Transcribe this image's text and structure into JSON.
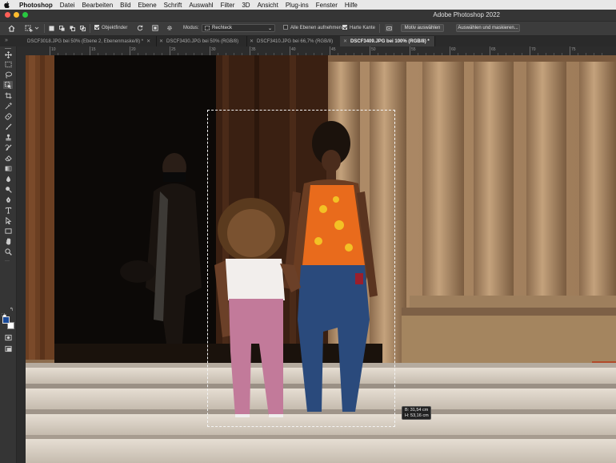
{
  "menubar": {
    "app": "Photoshop",
    "items": [
      "Datei",
      "Bearbeiten",
      "Bild",
      "Ebene",
      "Schrift",
      "Auswahl",
      "Filter",
      "3D",
      "Ansicht",
      "Plug-ins",
      "Fenster",
      "Hilfe"
    ]
  },
  "window": {
    "title": "Adobe Photoshop 2022",
    "traffic_lights": [
      "#fe5f57",
      "#febc2e",
      "#28c840"
    ]
  },
  "options_bar": {
    "object_finder_label": "Objektfinder",
    "object_finder_checked": true,
    "mode_label": "Modus:",
    "mode_value": "Rechteck",
    "all_layers_label": "Alle Ebenen aufnehmen",
    "all_layers_checked": false,
    "hard_edge_label": "Harte Kante",
    "hard_edge_checked": true,
    "select_subject_button": "Motiv auswählen",
    "select_and_mask_button": "Auswählen und maskieren..."
  },
  "tabs": [
    {
      "label": "DSCF3018.JPG bei 50% (Ebene 2, Ebenenmaske/8) *",
      "active": false
    },
    {
      "label": "DSCF3430.JPG bei 50% (RGB/8)",
      "active": false
    },
    {
      "label": "DSCF3410.JPG bei 66,7% (RGB/8)",
      "active": false
    },
    {
      "label": "DSCF3409.JPG bei 100% (RGB/8) *",
      "active": true
    }
  ],
  "ruler": {
    "h_labels": [
      "10",
      "15",
      "20",
      "25",
      "30",
      "35",
      "40",
      "45",
      "50",
      "55",
      "60",
      "65",
      "70",
      "75"
    ]
  },
  "tools": [
    "move-tool-icon",
    "marquee-tool-icon",
    "lasso-tool-icon",
    "object-selection-tool-icon",
    "crop-tool-icon",
    "eyedropper-tool-icon",
    "healing-brush-icon",
    "brush-tool-icon",
    "stamp-tool-icon",
    "history-brush-icon",
    "eraser-tool-icon",
    "gradient-tool-icon",
    "blur-tool-icon",
    "dodge-tool-icon",
    "pen-tool-icon",
    "type-tool-icon",
    "path-select-icon",
    "rectangle-tool-icon",
    "hand-tool-icon",
    "zoom-tool-icon"
  ],
  "colors": {
    "foreground": "#1a4a99",
    "background": "#ffffff",
    "accent": "#3a6ec6"
  },
  "selection_info": {
    "width": "B: 31,54 cm",
    "height": "H: 53,16 cm"
  }
}
